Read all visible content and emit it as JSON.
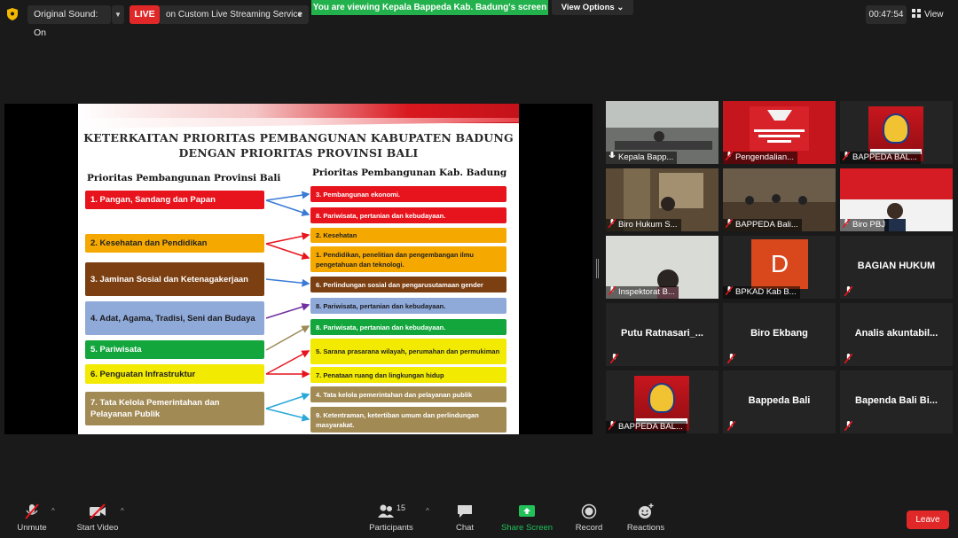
{
  "topbar": {
    "original_sound": "Original Sound: On",
    "live_badge": "LIVE",
    "live_service": "on Custom Live Streaming Service",
    "viewing_banner": "You are viewing Kepala Bappeda Kab. Badung's screen",
    "view_options": "View Options",
    "timer": "00:47:54",
    "view_label": "View"
  },
  "slide": {
    "title_line1": "KETERKAITAN PRIORITAS PEMBANGUNAN KABUPATEN  BADUNG",
    "title_line2": "DENGAN PRIORITAS PROVINSI BALI",
    "left_heading": "Prioritas Pembangunan Provinsi Bali",
    "right_heading": "Prioritas Pembangunan Kab. Badung",
    "left_items": [
      {
        "label": "1. Pangan, Sandang dan Papan",
        "color": "#e8141d"
      },
      {
        "label": "2. Kesehatan dan Pendidikan",
        "color": "#f5a800"
      },
      {
        "label": "3. Jaminan Sosial dan Ketenagakerjaan",
        "color": "#7b3f12"
      },
      {
        "label": "4. Adat, Agama, Tradisi, Seni dan Budaya",
        "color": "#8fa9d9"
      },
      {
        "label": "5. Pariwisata",
        "color": "#12a63c"
      },
      {
        "label": "6. Penguatan Infrastruktur",
        "color": "#f2ea00"
      },
      {
        "label": "7. Tata Kelola Pemerintahan dan Pelayanan Publik",
        "color": "#a28a55"
      }
    ],
    "right_items": [
      {
        "label": "3. Pembangunan ekonomi.",
        "color": "#e8141d"
      },
      {
        "label": "8. Pariwisata, pertanian dan kebudayaan.",
        "color": "#e8141d"
      },
      {
        "label": "2. Kesehatan",
        "color": "#f5a800"
      },
      {
        "label": "1. Pendidikan, penelitian dan pengembangan ilmu pengetahuan dan teknologi.",
        "color": "#f5a800"
      },
      {
        "label": "6. Perlindungan sosial dan pengarusutamaan gender",
        "color": "#7b3f12"
      },
      {
        "label": "8. Pariwisata, pertanian dan kebudayaan.",
        "color": "#8fa9d9"
      },
      {
        "label": "8. Pariwisata, pertanian dan kebudayaan.",
        "color": "#12a63c"
      },
      {
        "label": "5. Sarana prasarana wilayah, perumahan dan permukiman",
        "color": "#f2ea00"
      },
      {
        "label": "7. Penataan ruang dan lingkungan hidup",
        "color": "#f2ea00"
      },
      {
        "label": "4. Tata kelola pemerintahan dan pelayanan publik",
        "color": "#a28a55"
      },
      {
        "label": "9. Ketentraman, ketertiban umum dan perlindungan masyarakat.",
        "color": "#a28a55"
      }
    ]
  },
  "gallery": [
    {
      "name": "Kepala Bapp...",
      "type": "video"
    },
    {
      "name": "Pengendalian...",
      "type": "slide"
    },
    {
      "name": "BAPPEDA BAL...",
      "type": "logo"
    },
    {
      "name": "Biro Hukum S...",
      "type": "video"
    },
    {
      "name": "BAPPEDA Bali...",
      "type": "video"
    },
    {
      "name": "Biro PBJ",
      "type": "video"
    },
    {
      "name": "Inspektorat B...",
      "type": "video"
    },
    {
      "name": "BPKAD Kab B...",
      "type": "avatar",
      "initial": "D"
    },
    {
      "name": "BAGIAN HUKUM",
      "type": "text"
    },
    {
      "name": "Putu  Ratnasari_...",
      "type": "text"
    },
    {
      "name": "Biro Ekbang",
      "type": "text"
    },
    {
      "name": "Analis  akuntabil...",
      "type": "text"
    },
    {
      "name": "BAPPEDA BAL...",
      "type": "logo"
    },
    {
      "name": "Bappeda Bali",
      "type": "text"
    },
    {
      "name": "Bapenda  Bali  Bi...",
      "type": "text"
    }
  ],
  "toolbar": {
    "unmute": "Unmute",
    "start_video": "Start Video",
    "participants": "Participants",
    "participants_count": "15",
    "chat": "Chat",
    "share_screen": "Share Screen",
    "record": "Record",
    "reactions": "Reactions",
    "leave": "Leave"
  },
  "colors": {
    "live_red": "#e02828",
    "share_green": "#22b14c",
    "active_speaker": "#f5d94a"
  }
}
